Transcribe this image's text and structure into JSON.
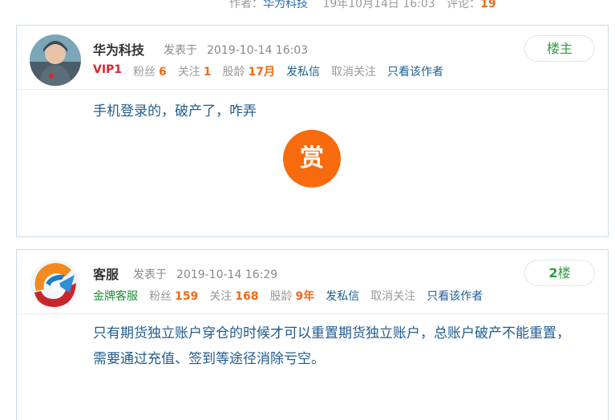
{
  "top_meta": {
    "author_label": "作者：",
    "author": "华为科技",
    "date": "19年10月14日 16:03",
    "comment_label": "评论：",
    "comment_count": "19"
  },
  "posts": [
    {
      "name": "华为科技",
      "posted_label": "发表于",
      "date": "2019-10-14 16:03",
      "badge": "VIP1",
      "fans_label": "粉丝",
      "fans": "6",
      "follow_label": "关注",
      "follow": "1",
      "age_label": "股龄",
      "age": "17月",
      "message_label": "发私信",
      "unfollow_label": "取消关注",
      "only_author_label": "只看该作者",
      "floor": "楼主",
      "content": "手机登录的，破产了，咋弄",
      "reward_label": "赏"
    },
    {
      "name": "客服",
      "posted_label": "发表于",
      "date": "2019-10-14 16:29",
      "badge": "金牌客服",
      "fans_label": "粉丝",
      "fans": "159",
      "follow_label": "关注",
      "follow": "168",
      "age_label": "股龄",
      "age": "9年",
      "message_label": "发私信",
      "unfollow_label": "取消关注",
      "only_author_label": "只看该作者",
      "floor_num": "2",
      "floor_suffix": "楼",
      "content": "只有期货独立账户穿仓的时候才可以重置期货独立账户，总账户破产不能重置，需要通过充值、签到等途径消除亏空。"
    }
  ],
  "colors": {
    "accent_orange": "#f06a1a",
    "link_blue": "#1d5e94",
    "vip_red": "#d9272e",
    "floor_green": "#2e9b3e"
  }
}
